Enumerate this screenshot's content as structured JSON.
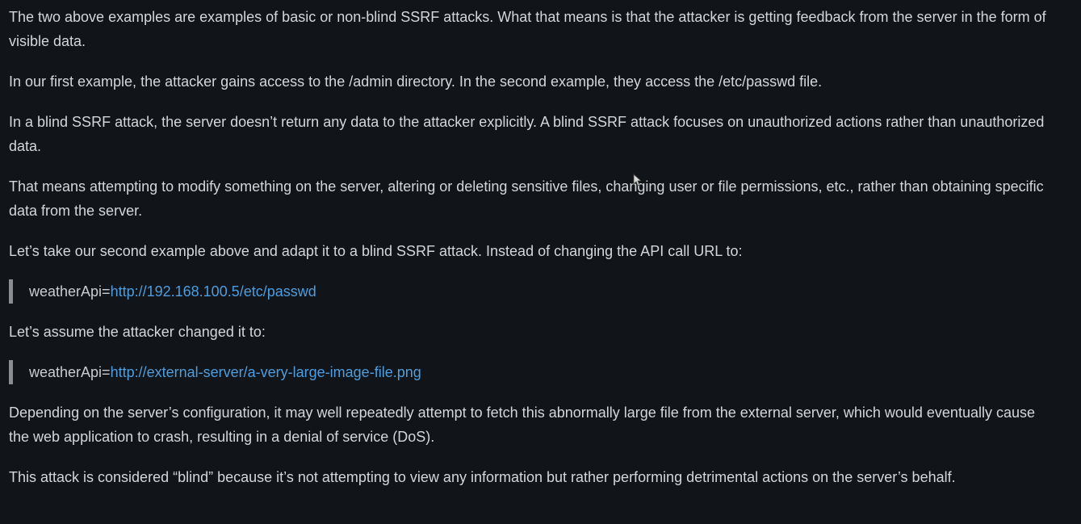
{
  "article": {
    "p1": "The two above examples are examples of basic or non-blind SSRF attacks. What that means is that the attacker is getting feedback from the server in the form of visible data.",
    "p2": "In our first example, the attacker gains access to the /admin directory. In the second example, they access the /etc/passwd file.",
    "p3": "In a blind SSRF attack, the server doesn’t return any data to the attacker explicitly. A blind SSRF attack focuses on unauthorized actions rather than unauthorized data.",
    "p4": "That means attempting to modify something on the server, altering or deleting sensitive files, changing user or file permissions, etc., rather than obtaining specific data from the server.",
    "p5": "Let’s take our second example above and adapt it to a blind SSRF attack. Instead of changing the API call URL to:",
    "quote1": {
      "prefix": "weatherApi=",
      "link": "http://192.168.100.5/etc/passwd"
    },
    "p6": "Let’s assume the attacker changed it to:",
    "quote2": {
      "prefix": "weatherApi=",
      "link": "http://external-server/a-very-large-image-file.png"
    },
    "p7": "Depending on the server’s configuration, it may well repeatedly attempt to fetch this abnormally large file from the external server, which would eventually cause the web application to crash, resulting in a denial of service (DoS).",
    "p8": "This attack is considered “blind” because it’s not attempting to view any information but rather performing detrimental actions on the server’s behalf."
  },
  "colors": {
    "background": "#111418",
    "text": "#d3d6da",
    "link": "#4d9de0",
    "quote_bar": "#8a8d91"
  },
  "icons": {
    "cursor": "mouse-pointer-icon"
  }
}
